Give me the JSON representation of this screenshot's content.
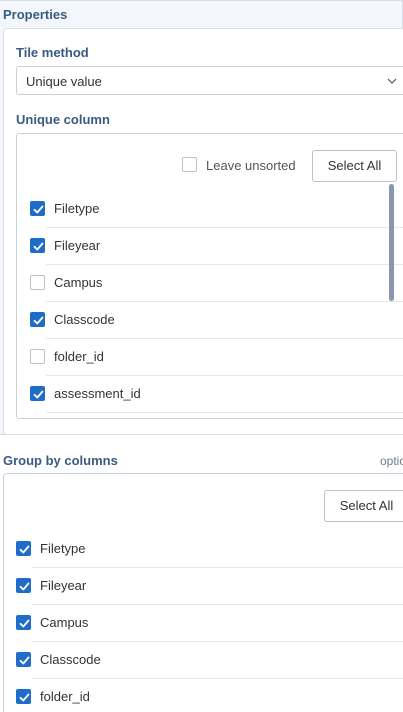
{
  "properties": {
    "title": "Properties"
  },
  "tile_method": {
    "label": "Tile method",
    "value": "Unique value"
  },
  "unique_column": {
    "label": "Unique column",
    "leave_unsorted_label": "Leave unsorted",
    "leave_unsorted_checked": false,
    "select_all_label": "Select All",
    "items": [
      {
        "label": "Filetype",
        "checked": true
      },
      {
        "label": "Fileyear",
        "checked": true
      },
      {
        "label": "Campus",
        "checked": false
      },
      {
        "label": "Classcode",
        "checked": true
      },
      {
        "label": "folder_id",
        "checked": false
      },
      {
        "label": "assessment_id",
        "checked": true
      }
    ]
  },
  "group_by": {
    "label": "Group by columns",
    "optional_label": "optio",
    "select_all_label": "Select All",
    "items": [
      {
        "label": "Filetype",
        "checked": true
      },
      {
        "label": "Fileyear",
        "checked": true
      },
      {
        "label": "Campus",
        "checked": true
      },
      {
        "label": "Classcode",
        "checked": true
      },
      {
        "label": "folder_id",
        "checked": true
      }
    ]
  },
  "colors": {
    "accent": "#1f6dc8",
    "label": "#3a5a86",
    "panel_bg": "#f3f6fb"
  }
}
